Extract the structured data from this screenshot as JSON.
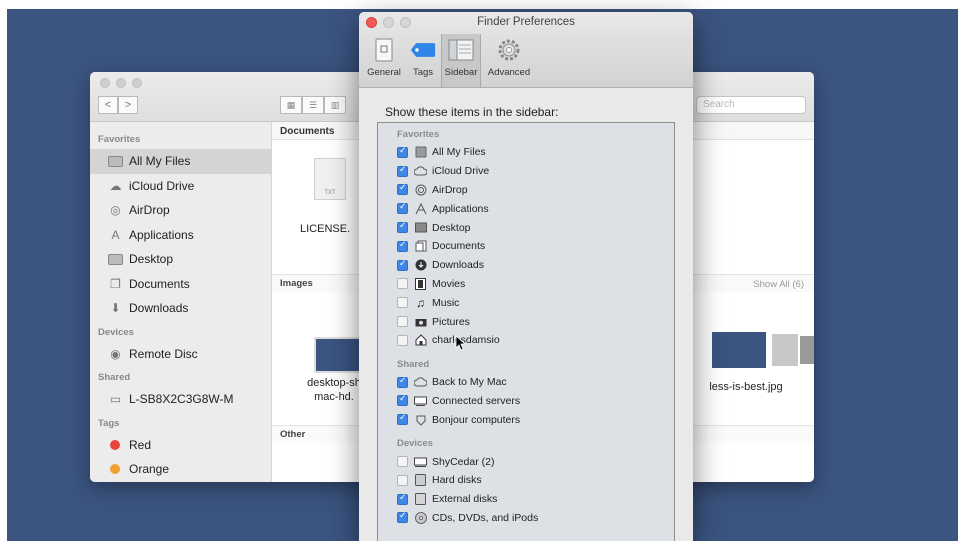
{
  "finder": {
    "nav_back": "<",
    "nav_forward": ">",
    "search_placeholder": "Search",
    "sidebar": {
      "favorites_header": "Favorites",
      "favorites": [
        {
          "label": "All My Files",
          "icon": "all-files-icon"
        },
        {
          "label": "iCloud Drive",
          "icon": "cloud-icon"
        },
        {
          "label": "AirDrop",
          "icon": "airdrop-icon"
        },
        {
          "label": "Applications",
          "icon": "applications-icon"
        },
        {
          "label": "Desktop",
          "icon": "desktop-icon"
        },
        {
          "label": "Documents",
          "icon": "documents-icon"
        },
        {
          "label": "Downloads",
          "icon": "downloads-icon"
        }
      ],
      "devices_header": "Devices",
      "devices": [
        {
          "label": "Remote Disc",
          "icon": "disc-icon"
        }
      ],
      "shared_header": "Shared",
      "shared": [
        {
          "label": "L-SB8X2C3G8W-M",
          "icon": "computer-icon"
        }
      ],
      "tags_header": "Tags",
      "tags": [
        {
          "label": "Red",
          "color": "#e8443a"
        },
        {
          "label": "Orange",
          "color": "#f0a030"
        }
      ]
    },
    "content": {
      "documents_header": "Documents",
      "doc_file": "LICENSE.",
      "doc_badge": "TXT",
      "images_header": "Images",
      "show_all": "Show All (6)",
      "image_file_1_line1": "desktop-sh",
      "image_file_1_line2": "mac-hd.",
      "image_file_2": "less-is-best.jpg",
      "other_header": "Other"
    }
  },
  "prefs": {
    "title": "Finder Preferences",
    "tabs": [
      {
        "label": "General",
        "icon": "general-icon"
      },
      {
        "label": "Tags",
        "icon": "tag-icon"
      },
      {
        "label": "Sidebar",
        "icon": "sidebar-icon",
        "active": true
      },
      {
        "label": "Advanced",
        "icon": "gear-icon"
      }
    ],
    "heading": "Show these items in the sidebar:",
    "favorites_header": "Favorites",
    "favorites": [
      {
        "label": "All My Files",
        "checked": true
      },
      {
        "label": "iCloud Drive",
        "checked": true
      },
      {
        "label": "AirDrop",
        "checked": true
      },
      {
        "label": "Applications",
        "checked": true
      },
      {
        "label": "Desktop",
        "checked": true
      },
      {
        "label": "Documents",
        "checked": true
      },
      {
        "label": "Downloads",
        "checked": true
      },
      {
        "label": "Movies",
        "checked": false
      },
      {
        "label": "Music",
        "checked": false
      },
      {
        "label": "Pictures",
        "checked": false
      },
      {
        "label": "charlesdamsio",
        "checked": false
      }
    ],
    "shared_header": "Shared",
    "shared": [
      {
        "label": "Back to My Mac",
        "checked": true
      },
      {
        "label": "Connected servers",
        "checked": true
      },
      {
        "label": "Bonjour computers",
        "checked": true
      }
    ],
    "devices_header": "Devices",
    "devices": [
      {
        "label": "ShyCedar (2)",
        "checked": false
      },
      {
        "label": "Hard disks",
        "checked": false
      },
      {
        "label": "External disks",
        "checked": true
      },
      {
        "label": "CDs, DVDs, and iPods",
        "checked": true
      }
    ]
  },
  "colors": {
    "desktop": "#3b5480",
    "checkbox_on": "#3d88e6",
    "close_button": "#f25a55"
  }
}
